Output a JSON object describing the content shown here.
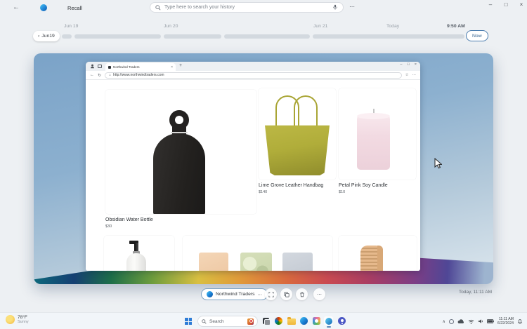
{
  "icons": {
    "back": "←",
    "forward": "→",
    "refresh": "↻",
    "home": "⌂",
    "more": "⋯",
    "minimize": "–",
    "maximize": "□",
    "close": "×",
    "chevron_left": "‹",
    "chevron_up": "∧",
    "plus": "+",
    "star": "☆",
    "tab_close": "×"
  },
  "header": {
    "title": "Recall",
    "search_placeholder": "Type here to search your history"
  },
  "timeline": {
    "day_labels": [
      "Jun 19",
      "Jun 20",
      "Jun 21",
      "Today"
    ],
    "time_label": "9:50 AM",
    "back_pill": "Jun19",
    "now_button": "Now"
  },
  "snapshot": {
    "browser": {
      "tab_title": "Northwind Traders",
      "url": "http://www.northwindtraders.com",
      "swatches": [
        "#3f3e3c",
        "#eae6d3",
        "#93badb"
      ],
      "products": [
        {
          "name": "Obsidian Water Bottle",
          "price": "$30"
        },
        {
          "name": "Lime Grove Leather Handbag",
          "price": "$140"
        },
        {
          "name": "Petal Pink Soy Candle",
          "price": "$10"
        }
      ]
    }
  },
  "toolbar": {
    "pill_label": "Northwind Traders",
    "timestamp": "Today, 11:11 AM"
  },
  "taskbar": {
    "weather_temp": "78°F",
    "weather_cond": "Sunny",
    "search_label": "Search",
    "clock_time": "11:11 AM",
    "clock_date": "6/22/2024"
  },
  "colors": {
    "accent_blue": "#3f74a8",
    "snapshot_bg_top": "#7ba3c8",
    "snapshot_bg_bottom": "#dde7ee",
    "handbag": "#b0ad3a",
    "candle": "#f2dae2",
    "bottle": "#242221"
  }
}
